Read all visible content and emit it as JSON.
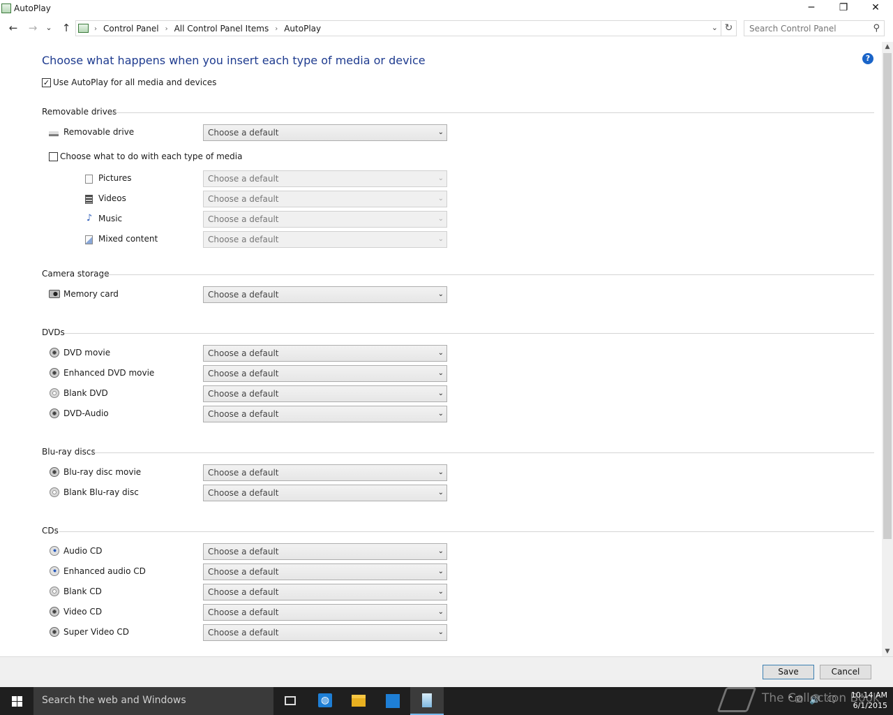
{
  "window": {
    "title": "AutoPlay",
    "minimize_glyph": "─",
    "maximize_glyph": "❐",
    "close_glyph": "✕"
  },
  "nav": {
    "back_glyph": "←",
    "forward_glyph": "→",
    "recent_glyph": "⌄",
    "up_glyph": "↑",
    "breadcrumbs": [
      "Control Panel",
      "All Control Panel Items",
      "AutoPlay"
    ],
    "sep_glyph": "›",
    "drop_glyph": "⌄",
    "refresh_glyph": "↻"
  },
  "search": {
    "placeholder": "Search Control Panel",
    "icon_glyph": "⚲"
  },
  "page": {
    "heading": "Choose what happens when you insert each type of media or device",
    "help_glyph": "?",
    "use_autoplay": {
      "label": "Use AutoPlay for all media and devices",
      "checked": true,
      "check_glyph": "✓"
    }
  },
  "default_choice": "Choose a default",
  "caret_glyph": "⌄",
  "sections": {
    "removable": {
      "title": "Removable drives",
      "drive_label": "Removable drive",
      "per_media_label": "Choose what to do with each type of media",
      "media": [
        {
          "label": "Pictures",
          "icon": "picture-icon"
        },
        {
          "label": "Videos",
          "icon": "video-icon"
        },
        {
          "label": "Music",
          "icon": "music-icon"
        },
        {
          "label": "Mixed content",
          "icon": "mixed-content-icon"
        }
      ],
      "music_glyph": "♪"
    },
    "camera": {
      "title": "Camera storage",
      "items": [
        "Memory card"
      ]
    },
    "dvds": {
      "title": "DVDs",
      "items": [
        "DVD movie",
        "Enhanced DVD movie",
        "Blank DVD",
        "DVD-Audio"
      ]
    },
    "bluray": {
      "title": "Blu-ray discs",
      "items": [
        "Blu-ray disc movie",
        "Blank Blu-ray disc"
      ]
    },
    "cds": {
      "title": "CDs",
      "items": [
        "Audio CD",
        "Enhanced audio CD",
        "Blank CD",
        "Video CD",
        "Super Video CD"
      ]
    }
  },
  "scroll": {
    "up_glyph": "▲",
    "down_glyph": "▼"
  },
  "footer": {
    "save_label": "Save",
    "cancel_label": "Cancel"
  },
  "taskbar": {
    "search_placeholder": "Search the web and Windows",
    "time": "10:14 AM",
    "date": "6/1/2015",
    "watermark": "The Collection Book",
    "tray_glyphs": [
      "⌃",
      "⎚",
      "🔊",
      "🗨"
    ]
  }
}
